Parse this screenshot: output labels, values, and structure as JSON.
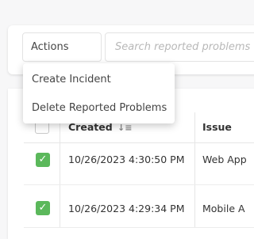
{
  "toolbar": {
    "actions_label": "Actions",
    "search_placeholder": "Search reported problems"
  },
  "actions_menu": {
    "items": [
      {
        "label": "Create Incident"
      },
      {
        "label": "Delete Reported Problems"
      }
    ]
  },
  "table": {
    "columns": [
      {
        "label": "Created",
        "sort_icon": "↓≡"
      },
      {
        "label": "Issue"
      }
    ],
    "rows": [
      {
        "checked": true,
        "created": "10/26/2023 4:30:50 PM",
        "issue": "Web App"
      },
      {
        "checked": true,
        "created": "10/26/2023 4:29:34 PM",
        "issue": "Mobile A"
      }
    ]
  },
  "colors": {
    "checkbox_checked": "#5bb85b",
    "background": "#f7f7f8"
  }
}
